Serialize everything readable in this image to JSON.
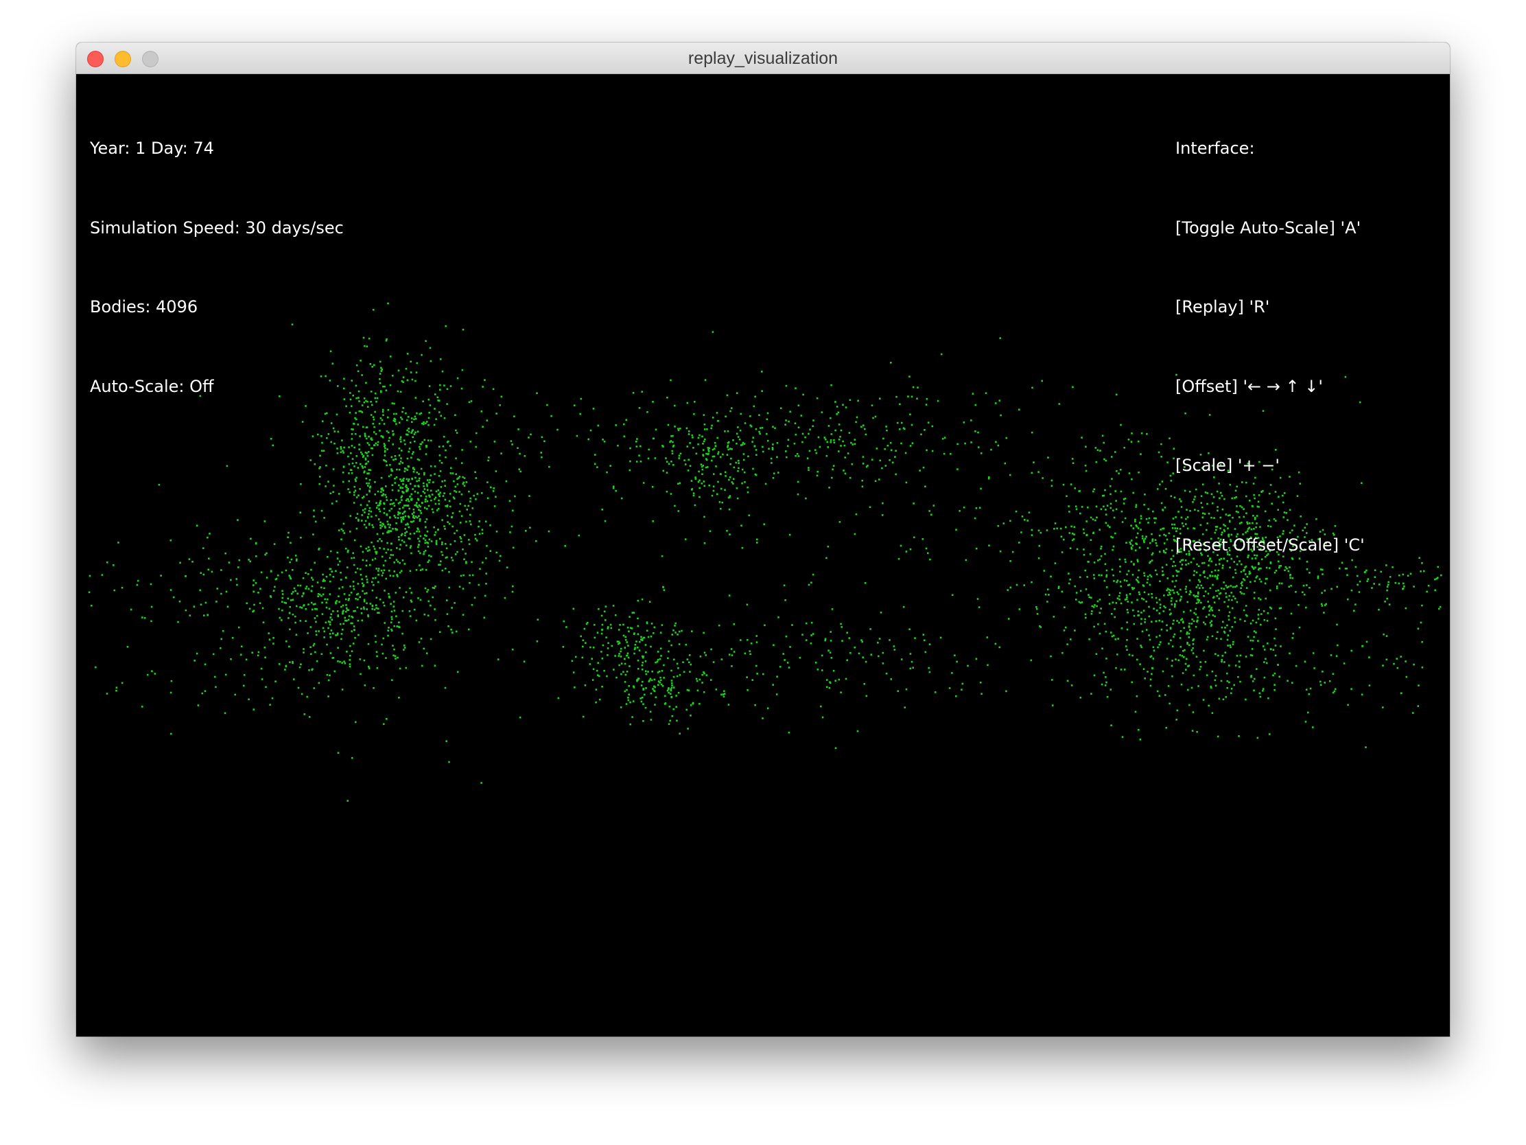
{
  "window": {
    "title": "replay_visualization"
  },
  "status": {
    "year_day": "Year: 1 Day: 74",
    "speed": "Simulation Speed: 30 days/sec",
    "bodies": "Bodies: 4096",
    "auto_scale": "Auto-Scale: Off"
  },
  "interface": {
    "heading": "Interface:",
    "toggle_auto_scale": "[Toggle Auto-Scale] 'A'",
    "replay": "[Replay] 'R'",
    "offset": "[Offset] '← → ↑ ↓'",
    "scale": "[Scale] '+ −'",
    "reset": "[Reset Offset/Scale] 'C'"
  },
  "colors": {
    "background": "#000000",
    "text": "#ffffff",
    "body": "#1fd11f"
  }
}
